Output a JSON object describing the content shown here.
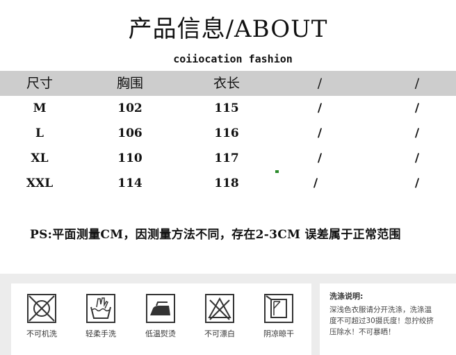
{
  "title": "产品信息/ABOUT",
  "brand": "coiiocation fashion",
  "table": {
    "headers": [
      "尺寸",
      "胸围",
      "衣长",
      "/",
      "/"
    ],
    "rows": [
      [
        "M",
        "102",
        "115",
        "/",
        "/"
      ],
      [
        "L",
        "106",
        "116",
        "/",
        "/"
      ],
      [
        "XL",
        "110",
        "117",
        "/",
        "/"
      ],
      [
        "XXL",
        "114",
        "118",
        "/",
        "/"
      ]
    ]
  },
  "note": "PS:平面测量CM，因测量方法不同，存在2-3CM 误差属于正常范围",
  "care": {
    "items": [
      {
        "icon": "no-machine-wash-icon",
        "label": "不可机洗"
      },
      {
        "icon": "hand-wash-icon",
        "label": "轻柔手洗"
      },
      {
        "icon": "low-temp-iron-icon",
        "label": "低温熨烫"
      },
      {
        "icon": "no-bleach-icon",
        "label": "不可漂白"
      },
      {
        "icon": "shade-dry-icon",
        "label": "阴凉晾干"
      }
    ],
    "wash_title": "洗涤说明:",
    "wash_lines": [
      "深浅色衣服请分开洗涤，洗涤温",
      "度不可超过30摄氏度！忽拧绞挤",
      "压除水！不可暴晒！"
    ]
  }
}
